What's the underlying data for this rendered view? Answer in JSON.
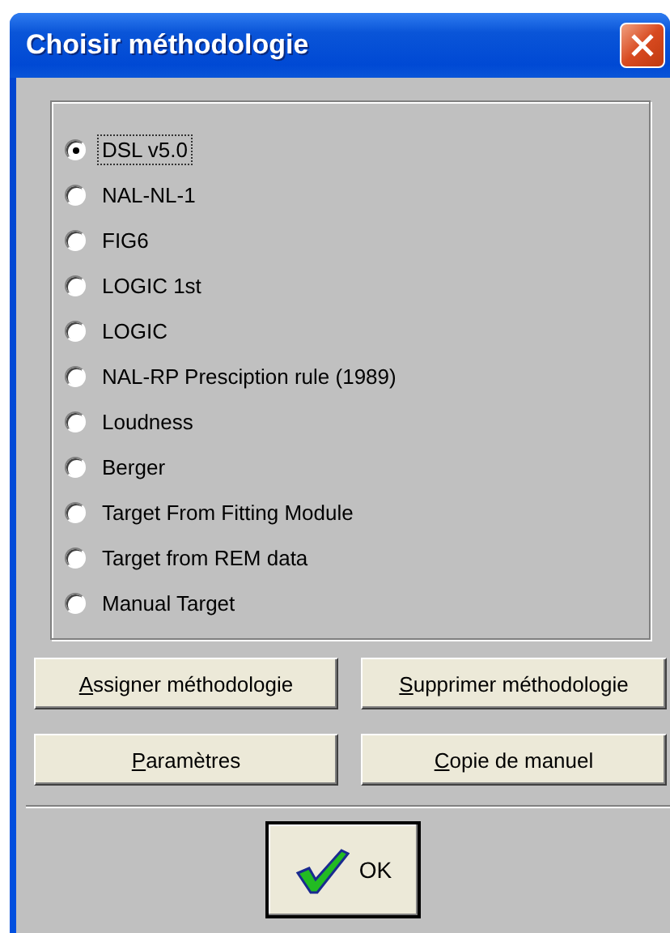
{
  "window": {
    "title": "Choisir méthodologie"
  },
  "methods": [
    {
      "label": "DSL v5.0",
      "selected": true
    },
    {
      "label": "NAL-NL-1",
      "selected": false
    },
    {
      "label": "FIG6",
      "selected": false
    },
    {
      "label": "LOGIC 1st",
      "selected": false
    },
    {
      "label": "LOGIC",
      "selected": false
    },
    {
      "label": "NAL-RP Presciption rule (1989)",
      "selected": false
    },
    {
      "label": "Loudness",
      "selected": false
    },
    {
      "label": "Berger",
      "selected": false
    },
    {
      "label": "Target From Fitting Module",
      "selected": false
    },
    {
      "label": "Target from REM data",
      "selected": false
    },
    {
      "label": "Manual Target",
      "selected": false
    }
  ],
  "buttons": [
    {
      "label": "Assigner méthodologie"
    },
    {
      "label": "Supprimer méthodologie"
    },
    {
      "label": "Paramètres"
    },
    {
      "label": "Copie de manuel"
    }
  ],
  "ok_button": {
    "label": "OK"
  }
}
